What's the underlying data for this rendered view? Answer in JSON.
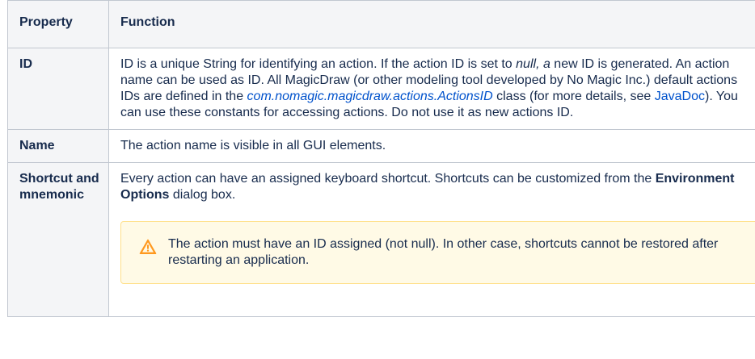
{
  "header": {
    "col_property": "Property",
    "col_function": "Function"
  },
  "rows": [
    {
      "property": "ID",
      "fn": {
        "t1": "ID is a unique String for identifying an action. If the action ID is set to ",
        "t2_italic": "null, a",
        "t3": " new ID is generated. An action name can be used as ID. All MagicDraw (or other modeling tool developed by No Magic Inc.) default actions IDs are defined in the ",
        "link1": "com.nomagic.​magicdraw.actions.ActionsID",
        "t4": " class (for more details, see ",
        "link2": "JavaDoc",
        "t5": "). You can use these constants for accessing actions. Do not use it as new actions ID."
      }
    },
    {
      "property": "Name",
      "fn": {
        "text": "The action name is visible in all GUI elements."
      }
    },
    {
      "property": "Shortcut and mnemonic",
      "fn": {
        "t1": "Every action can have an assigned keyboard shortcut. Shortcuts can be customized from the ",
        "bold": "Environment Options",
        "t2": " dialog box.",
        "warning": "The action must have an ID assigned (not null). In other case, shortcuts cannot be restored after restarting an application.",
        "warning_icon": "warning-triangle-icon"
      }
    }
  ],
  "colors": {
    "header_bg": "#f4f5f7",
    "border": "#c1c7d0",
    "link": "#0052cc",
    "warning_bg": "#fffae6",
    "warning_border": "#ffe08a",
    "warning_icon": "#ff991f"
  }
}
